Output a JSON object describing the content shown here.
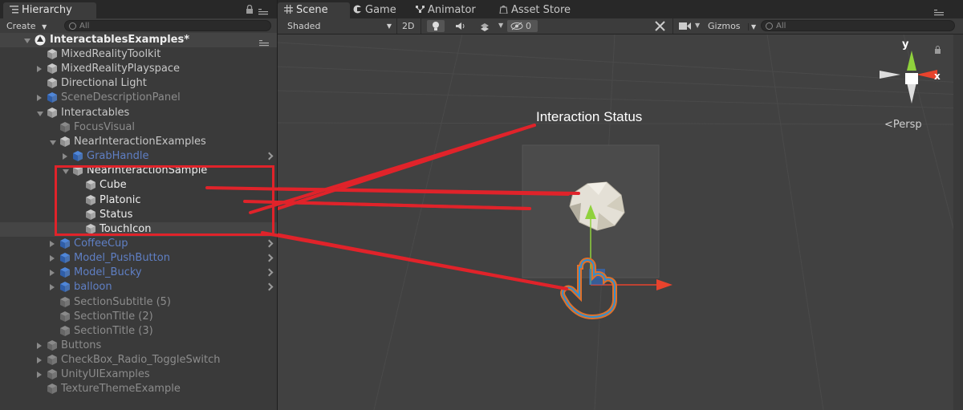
{
  "hierarchy": {
    "tab_label": "Hierarchy",
    "create_label": "Create",
    "search_placeholder": "All",
    "scene_name": "InteractablesExamples*",
    "items": [
      {
        "label": "MixedRealityToolkit"
      },
      {
        "label": "MixedRealityPlayspace"
      },
      {
        "label": "Directional Light"
      },
      {
        "label": "SceneDescriptionPanel"
      },
      {
        "label": "Interactables"
      },
      {
        "label": "FocusVisual"
      },
      {
        "label": "NearInteractionExamples"
      },
      {
        "label": "GrabHandle"
      },
      {
        "label": "NearInteractionSample"
      },
      {
        "label": "Cube"
      },
      {
        "label": "Platonic"
      },
      {
        "label": "Status"
      },
      {
        "label": "TouchIcon"
      },
      {
        "label": "CoffeeCup"
      },
      {
        "label": "Model_PushButton"
      },
      {
        "label": "Model_Bucky"
      },
      {
        "label": "balloon"
      },
      {
        "label": "SectionSubtitle (5)"
      },
      {
        "label": "SectionTitle (2)"
      },
      {
        "label": "SectionTitle (3)"
      },
      {
        "label": "Buttons"
      },
      {
        "label": "CheckBox_Radio_ToggleSwitch"
      },
      {
        "label": "UnityUIExamples"
      },
      {
        "label": "TextureThemeExample"
      }
    ]
  },
  "tabs": {
    "scene": "Scene",
    "game": "Game",
    "animator": "Animator",
    "asset_store": "Asset Store"
  },
  "scene_toolbar": {
    "shading": "Shaded",
    "mode_2d": "2D",
    "hidden_count": "0",
    "gizmos": "Gizmos",
    "search_placeholder": "All"
  },
  "viewport": {
    "annotation": "Interaction Status",
    "gizmo_y": "y",
    "gizmo_x": "x",
    "projection": "Persp"
  },
  "colors": {
    "annotation_red": "#e0232a",
    "prefab_blue": "#5f7fc4",
    "gizmo_y_green": "#8fd13c",
    "gizmo_x_red": "#e8432d",
    "touch_icon_orange": "#e0712a",
    "touch_icon_blue": "#2f8fd0"
  },
  "icons": [
    "hierarchy-list-icon",
    "lock-icon",
    "menu-icon",
    "unity-scene-icon",
    "game-object-icon",
    "prefab-icon",
    "scene-tab-icon",
    "game-tab-icon",
    "animator-tab-icon",
    "asset-store-icon",
    "light-icon",
    "audio-icon",
    "effects-icon",
    "visibility-icon",
    "tools-icon",
    "camera-icon",
    "search-icon",
    "hand-icon"
  ]
}
